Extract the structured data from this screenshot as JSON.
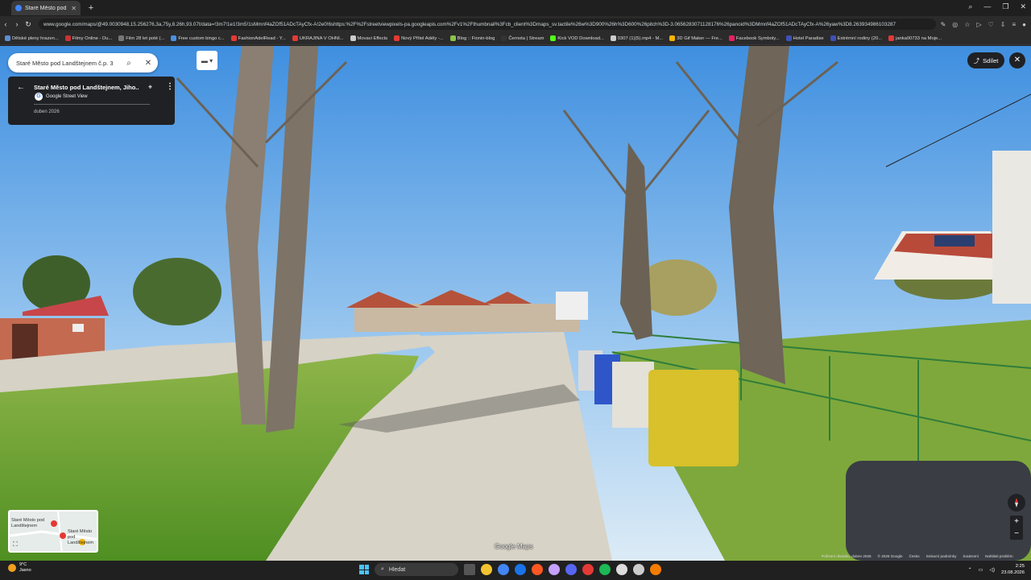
{
  "browser": {
    "tab_title": "Staré Město pod Landštejnem",
    "url": "www.google.com/maps/@49.0030948,15.256276,3a,75y,8.26h,93.07t/data=!3m7!1e1!3m5!1sMmnf4aZOf51ADcTAyCfx-A!2e0!6shttps:%2F%2Fstreetviewpixels-pa.googleapis.com%2Fv1%2Fthumbnail%3Fcb_client%3Dmaps_sv.tactile%26w%3D900%26h%3D600%26pitch%3D-3.0656283071128176%26panoid%3DMmnf4aZOf51ADcTAyCfx-A%26yaw%3D8.263934986103287",
    "bookmarks": [
      {
        "label": "Dětské pleny hrazen...",
        "color": "#5f8dd3"
      },
      {
        "label": "Filmy Online - Du...",
        "color": "#cc3333"
      },
      {
        "label": "Film 28 let poté (...",
        "color": "#777777"
      },
      {
        "label": "Free custom bingo c...",
        "color": "#4a90e2"
      },
      {
        "label": "FashionAdelRead - Y...",
        "color": "#e53935"
      },
      {
        "label": "UKRAJINA V OHNI...",
        "color": "#e53935"
      },
      {
        "label": "Movavi Effects",
        "color": "#cccccc"
      },
      {
        "label": "Nový Přítel Adély -...",
        "color": "#e53935"
      },
      {
        "label": "Blog :: Fionin-blog",
        "color": "#8bc34a"
      },
      {
        "label": "Černota | Stream",
        "color": "#333333"
      },
      {
        "label": "Kick VOD Download...",
        "color": "#53fc18"
      },
      {
        "label": "0307 (1)(5).mp4 - M...",
        "color": "#cccccc"
      },
      {
        "label": "3D Gif Maker — Fre...",
        "color": "#f4b400"
      },
      {
        "label": "Facebook Symboly...",
        "color": "#e91e63"
      },
      {
        "label": "Hotel Paradise",
        "color": "#3f51b5"
      },
      {
        "label": "Extrémní rodiny (20...",
        "color": "#3f51b5"
      },
      {
        "label": "janka00733 na Moje...",
        "color": "#e53935"
      }
    ]
  },
  "maps": {
    "search_text": "Staré Město pod Landštejnem č.p. 3",
    "place_title": "Staré Město pod Landštejnem, Jiho...",
    "source_label": "Google Street View",
    "capture_date": "duben 2026",
    "share_label": "Sdílet",
    "watermark": "Google Maps",
    "minimap_label_1": "Staré Město pod Landštejnem",
    "minimap_label_2": "Staré Město pod Landštejnem",
    "footer": [
      "Pořízení obrázku: duben 2026",
      "© 2026 Google",
      "Česko",
      "Smluvní podmínky",
      "Soukromí",
      "Nahlásit problém"
    ]
  },
  "taskbar": {
    "temperature": "9°C",
    "weather": "Jasno",
    "search_placeholder": "Hledat",
    "time": "2:25",
    "date": "23.08.2026",
    "app_colors": [
      "#555555",
      "#f4c430",
      "#4285f4",
      "#1a73e8",
      "#ff5722",
      "#c6a0ff",
      "#5865f2",
      "#e53935",
      "#1db954",
      "#dddddd",
      "#cccccc",
      "#f57c00"
    ]
  }
}
